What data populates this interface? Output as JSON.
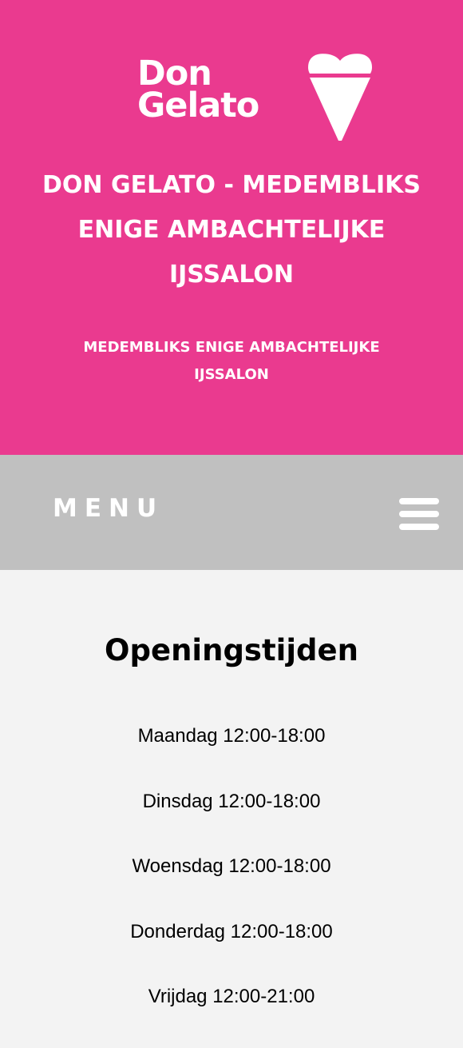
{
  "header": {
    "logo": {
      "line1": "Don",
      "line2": "Gelato",
      "icon": "ice-cream-heart-icon"
    },
    "title": "DON GELATO - MEDEMBLIKS ENIGE AMBACHTELIJKE IJSSALON",
    "tagline": "MEDEMBLIKS ENIGE AMBACHTELIJKE IJSSALON",
    "background_color": "#ea3a8f"
  },
  "nav": {
    "menu_label": "MENU",
    "menu_icon": "hamburger-icon",
    "background_color": "#c0c0c0"
  },
  "opening_hours": {
    "heading": "Openingstijden",
    "days": [
      {
        "label": "Maandag 12:00-18:00"
      },
      {
        "label": "Dinsdag 12:00-18:00"
      },
      {
        "label": "Woensdag 12:00-18:00"
      },
      {
        "label": "Donderdag 12:00-18:00"
      },
      {
        "label": "Vrijdag 12:00-21:00"
      }
    ]
  }
}
